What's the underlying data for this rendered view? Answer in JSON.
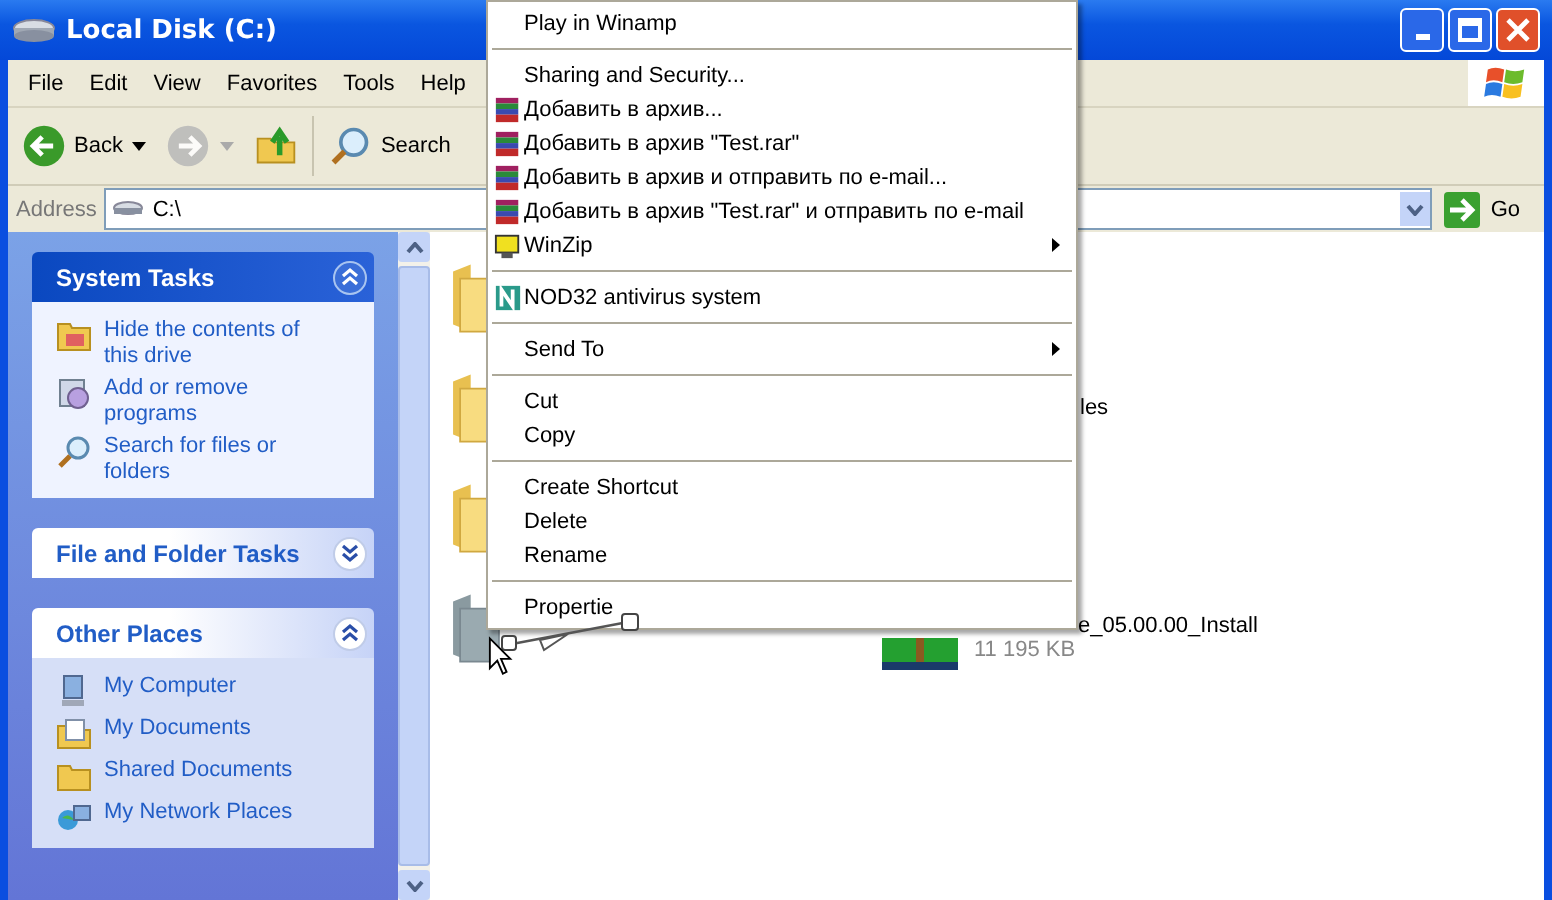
{
  "window": {
    "title": "Local Disk (C:)"
  },
  "menu_bar": [
    "File",
    "Edit",
    "View",
    "Favorites",
    "Tools",
    "Help"
  ],
  "toolbar": [
    {
      "kind": "back",
      "label": "Back",
      "disabled": false
    },
    {
      "kind": "forward",
      "disabled": true
    },
    {
      "kind": "up",
      "disabled": false
    },
    {
      "kind": "search",
      "label": "Search",
      "disabled": false
    }
  ],
  "address_bar": {
    "label": "Address",
    "value": "C:\\",
    "go": "Go"
  },
  "task_panels": [
    {
      "title": "System Tasks",
      "expanded": true,
      "special": true,
      "items": [
        {
          "kind": "view",
          "label": "Hide the contents of this drive"
        },
        {
          "kind": "programs",
          "label": "Add or remove programs"
        },
        {
          "kind": "search",
          "label": "Search for files or folders"
        }
      ]
    },
    {
      "title": "File and Folder Tasks",
      "expanded": false,
      "special": false
    },
    {
      "title": "Other Places",
      "expanded": true,
      "special": false,
      "items": [
        {
          "kind": "computer",
          "label": "My Computer"
        },
        {
          "kind": "documents",
          "label": "My Documents"
        },
        {
          "kind": "folder",
          "label": "Shared Documents"
        },
        {
          "kind": "network",
          "label": "My Network Places"
        }
      ]
    }
  ],
  "files": [
    {
      "kind": "folder",
      "selected": false
    },
    {
      "kind": "folder",
      "name": "les",
      "selected": false
    },
    {
      "kind": "folder",
      "selected": false
    },
    {
      "kind": "folder",
      "selected": true
    },
    {
      "kind": "archive",
      "name": "e_05.00.00_Install",
      "detail": "11 195 KB",
      "selected": false
    }
  ],
  "context_menu": [
    [
      {
        "label": "Play in Winamp",
        "kind": "plain",
        "submenu": false
      }
    ],
    [
      {
        "label": "Sharing and Security...",
        "kind": "plain",
        "submenu": false
      },
      {
        "label": "Добавить в архив...",
        "kind": "winrar",
        "submenu": false
      },
      {
        "label": "Добавить в архив \"Test.rar\"",
        "kind": "winrar",
        "submenu": false
      },
      {
        "label": "Добавить в архив и отправить по e-mail...",
        "kind": "winrar",
        "submenu": false
      },
      {
        "label": "Добавить в архив \"Test.rar\" и отправить по e-mail",
        "kind": "winrar",
        "submenu": false
      },
      {
        "label": "WinZip",
        "kind": "winzip",
        "submenu": true
      }
    ],
    [
      {
        "label": "NOD32 antivirus system",
        "kind": "nod32",
        "submenu": false
      }
    ],
    [
      {
        "label": "Send To",
        "kind": "plain",
        "submenu": true
      }
    ],
    [
      {
        "label": "Cut",
        "kind": "plain",
        "submenu": false
      },
      {
        "label": "Copy",
        "kind": "plain",
        "submenu": false
      }
    ],
    [
      {
        "label": "Create Shortcut",
        "kind": "plain",
        "submenu": false
      },
      {
        "label": "Delete",
        "kind": "plain",
        "submenu": false
      },
      {
        "label": "Rename",
        "kind": "plain",
        "submenu": false
      }
    ],
    [
      {
        "label": "Propertie",
        "kind": "plain",
        "submenu": false
      }
    ]
  ]
}
